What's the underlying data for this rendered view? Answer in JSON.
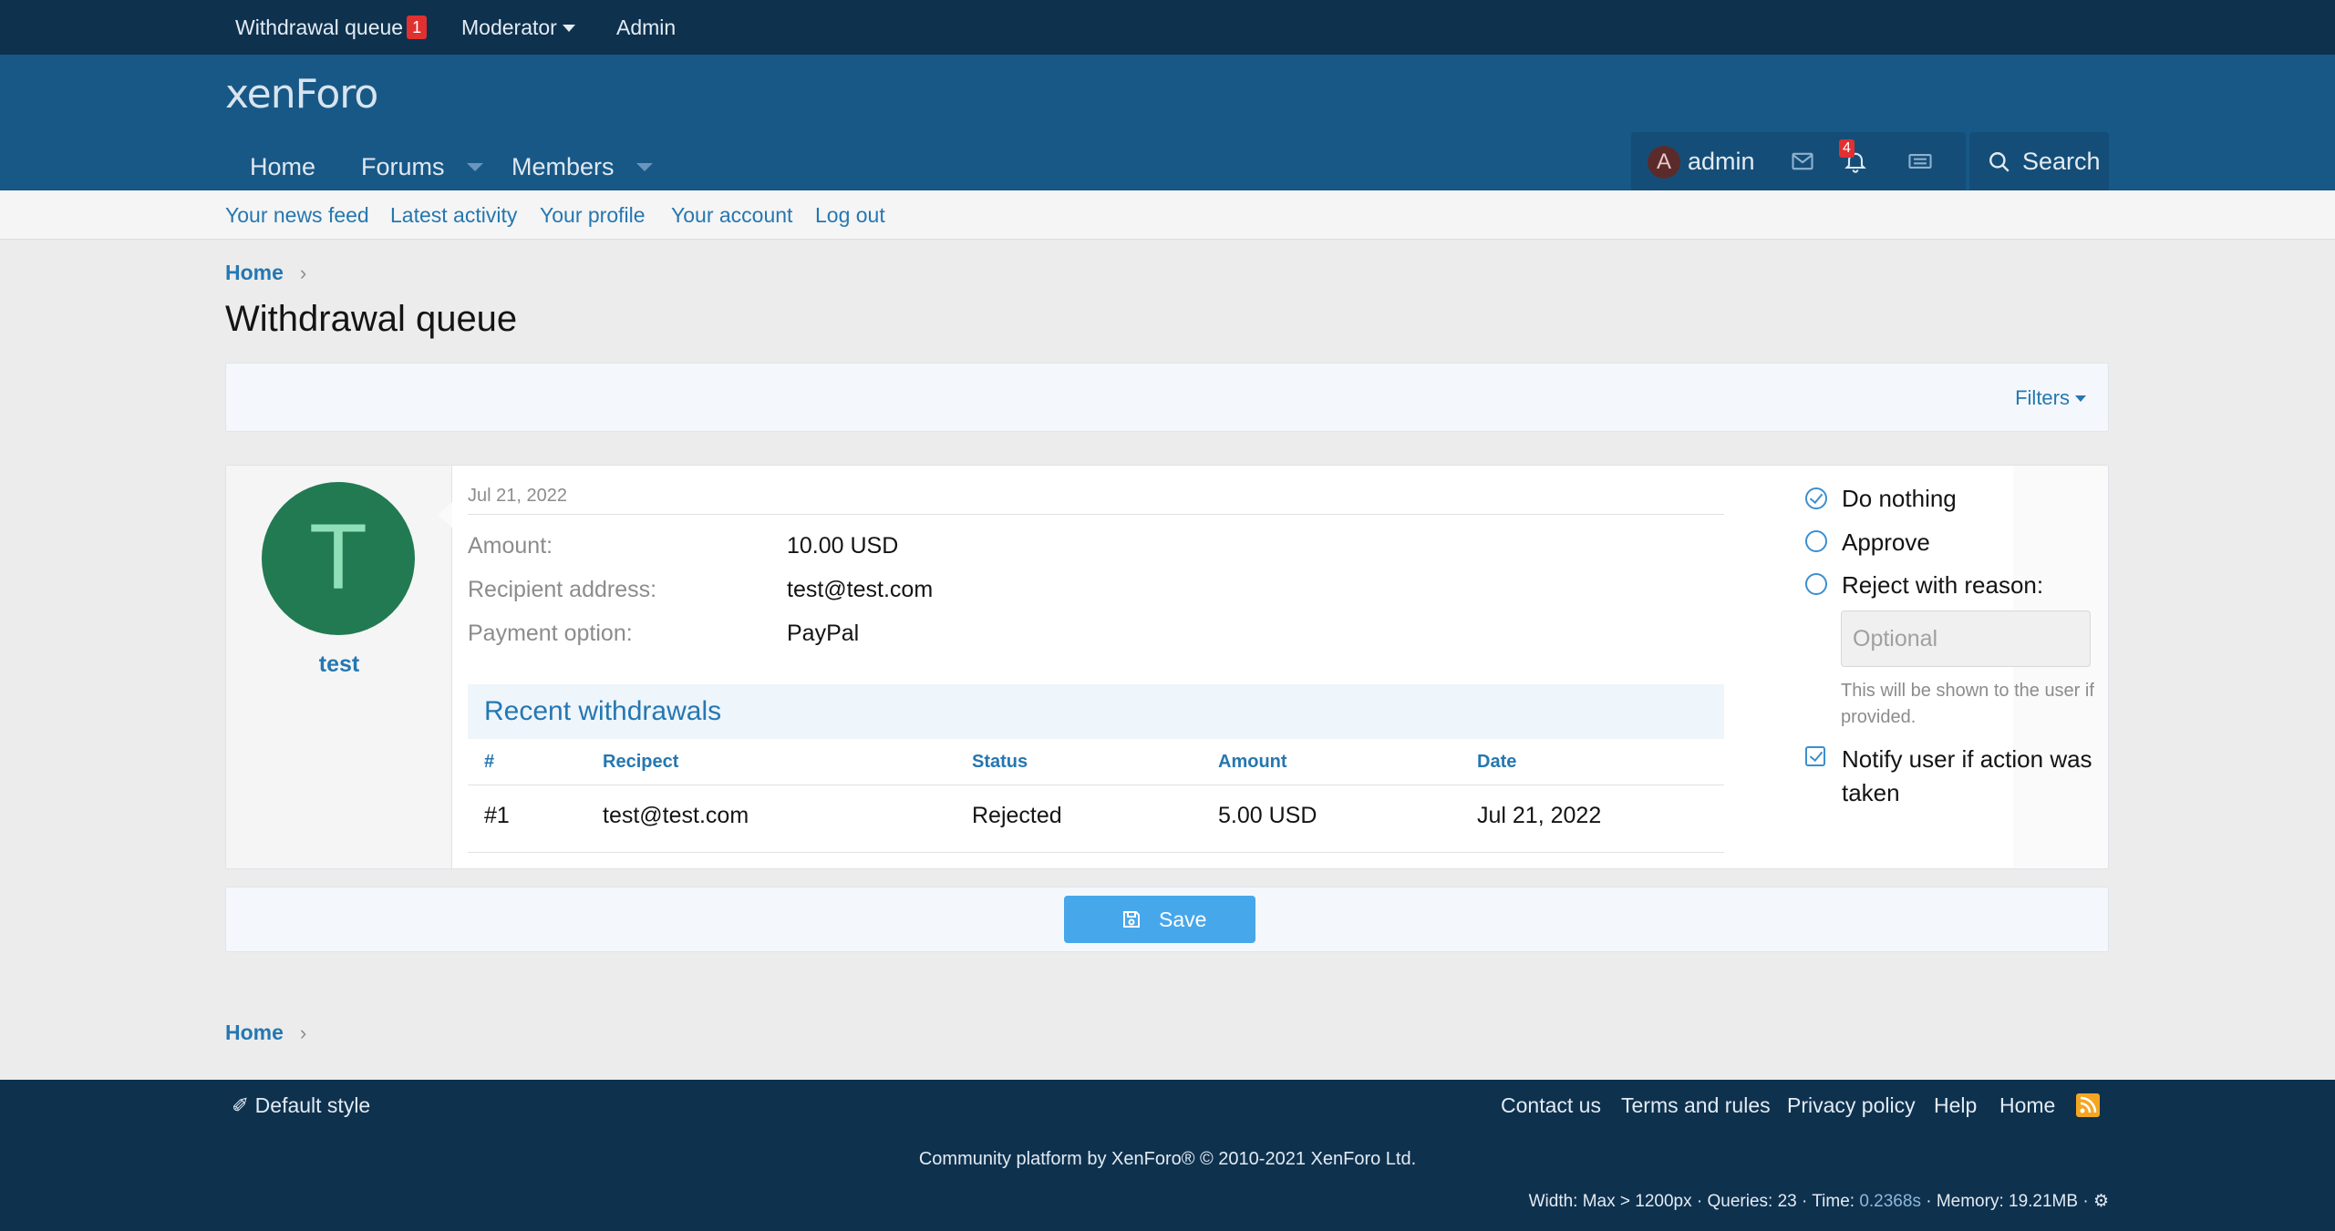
{
  "staffbar": {
    "withdrawal_queue": "Withdrawal queue",
    "withdrawal_count": "1",
    "moderator": "Moderator",
    "admin": "Admin"
  },
  "header": {
    "logo": "xenForo",
    "nav": {
      "home": "Home",
      "forums": "Forums",
      "members": "Members"
    },
    "user": {
      "avatar_letter": "A",
      "name": "admin",
      "alerts_count": "4"
    },
    "search": "Search"
  },
  "subnav": [
    "Your news feed",
    "Latest activity",
    "Your profile",
    "Your account",
    "Log out"
  ],
  "breadcrumb": {
    "home": "Home"
  },
  "page_title": "Withdrawal queue",
  "filters": "Filters",
  "request": {
    "user": {
      "avatar_letter": "T",
      "name": "test"
    },
    "date": "Jul 21, 2022",
    "fields": [
      {
        "label": "Amount:",
        "value": "10.00 USD"
      },
      {
        "label": "Recipient address:",
        "value": "test@test.com"
      },
      {
        "label": "Payment option:",
        "value": "PayPal"
      }
    ],
    "recent": {
      "title": "Recent withdrawals",
      "columns": [
        "#",
        "Recipect",
        "Status",
        "Amount",
        "Date"
      ],
      "rows": [
        [
          "#1",
          "test@test.com",
          "Rejected",
          "5.00 USD",
          "Jul 21, 2022"
        ]
      ]
    },
    "actions": {
      "do_nothing": "Do nothing",
      "approve": "Approve",
      "reject": "Reject with reason:",
      "reason_placeholder": "Optional",
      "hint": "This will be shown to the user if provided.",
      "notify": "Notify user if action was taken"
    }
  },
  "save": "Save",
  "footer": {
    "style": "Default style",
    "links": [
      "Contact us",
      "Terms and rules",
      "Privacy policy",
      "Help",
      "Home"
    ],
    "copyright": "Community platform by XenForo® © 2010-2021 XenForo Ltd.",
    "stats_prefix": "Width: Max > 1200px · Queries: 23 · Time: ",
    "stats_time": "0.2368s",
    "stats_suffix": " · Memory: 19.21MB · "
  },
  "colors": {
    "header": "#185886",
    "staffbar": "#0e314e",
    "link": "#2577b1",
    "save": "#47a7eb",
    "avatar": "#217a52"
  }
}
